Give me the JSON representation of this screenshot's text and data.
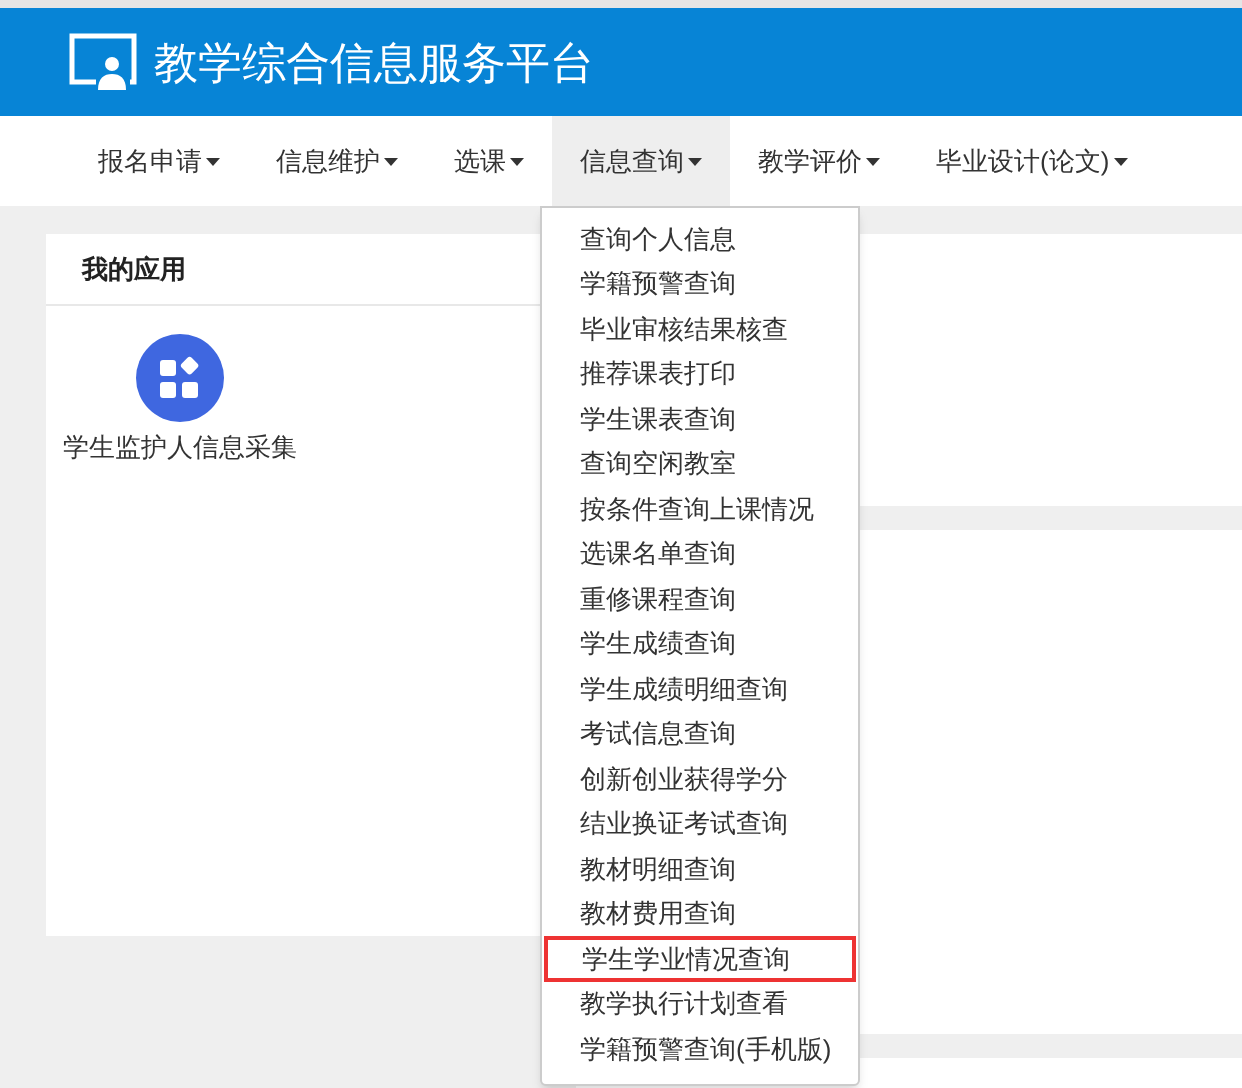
{
  "header": {
    "title": "教学综合信息服务平台"
  },
  "nav": [
    {
      "label": "报名申请",
      "selected": false
    },
    {
      "label": "信息维护",
      "selected": false
    },
    {
      "label": "选课",
      "selected": false
    },
    {
      "label": "信息查询",
      "selected": true
    },
    {
      "label": "教学评价",
      "selected": false
    },
    {
      "label": "毕业设计(论文)",
      "selected": false
    }
  ],
  "dropdown": [
    {
      "label": "查询个人信息",
      "highlighted": false
    },
    {
      "label": "学籍预警查询",
      "highlighted": false
    },
    {
      "label": "毕业审核结果核查",
      "highlighted": false
    },
    {
      "label": "推荐课表打印",
      "highlighted": false
    },
    {
      "label": "学生课表查询",
      "highlighted": false
    },
    {
      "label": "查询空闲教室",
      "highlighted": false
    },
    {
      "label": "按条件查询上课情况",
      "highlighted": false
    },
    {
      "label": "选课名单查询",
      "highlighted": false
    },
    {
      "label": "重修课程查询",
      "highlighted": false
    },
    {
      "label": "学生成绩查询",
      "highlighted": false
    },
    {
      "label": "学生成绩明细查询",
      "highlighted": false
    },
    {
      "label": "考试信息查询",
      "highlighted": false
    },
    {
      "label": "创新创业获得学分",
      "highlighted": false
    },
    {
      "label": "结业换证考试查询",
      "highlighted": false
    },
    {
      "label": "教材明细查询",
      "highlighted": false
    },
    {
      "label": "教材费用查询",
      "highlighted": false
    },
    {
      "label": "学生学业情况查询",
      "highlighted": true
    },
    {
      "label": "教学执行计划查看",
      "highlighted": false
    },
    {
      "label": "学籍预警查询(手机版)",
      "highlighted": false
    }
  ],
  "my_apps": {
    "title": "我的应用",
    "apps": [
      {
        "label": "学生监护人信息采集"
      }
    ]
  }
}
